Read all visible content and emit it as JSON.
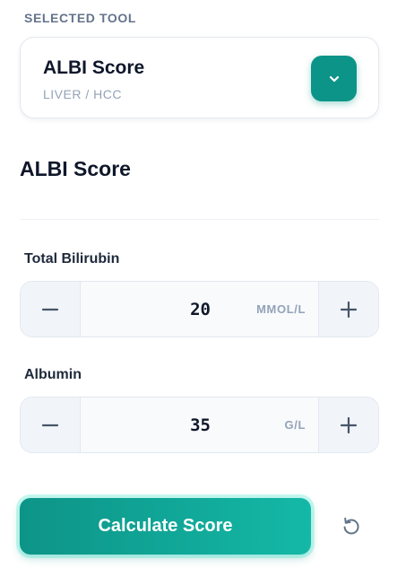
{
  "selector": {
    "section_label": "SELECTED TOOL",
    "tool_name": "ALBI Score",
    "tool_category": "LIVER / HCC",
    "toggle_icon": "chevron-down-icon"
  },
  "calculator": {
    "title": "ALBI Score",
    "fields": [
      {
        "label": "Total Bilirubin",
        "value": "20",
        "unit": "MMOL/L",
        "decrement_icon": "minus-icon",
        "increment_icon": "plus-icon"
      },
      {
        "label": "Albumin",
        "value": "35",
        "unit": "G/L",
        "decrement_icon": "minus-icon",
        "increment_icon": "plus-icon"
      }
    ]
  },
  "actions": {
    "calculate_label": "Calculate Score",
    "reset_icon": "reset-icon"
  },
  "colors": {
    "accent": "#0d9488",
    "accent_light": "#14b8a6",
    "muted_text": "#94a3b8",
    "label_text": "#64748b"
  }
}
